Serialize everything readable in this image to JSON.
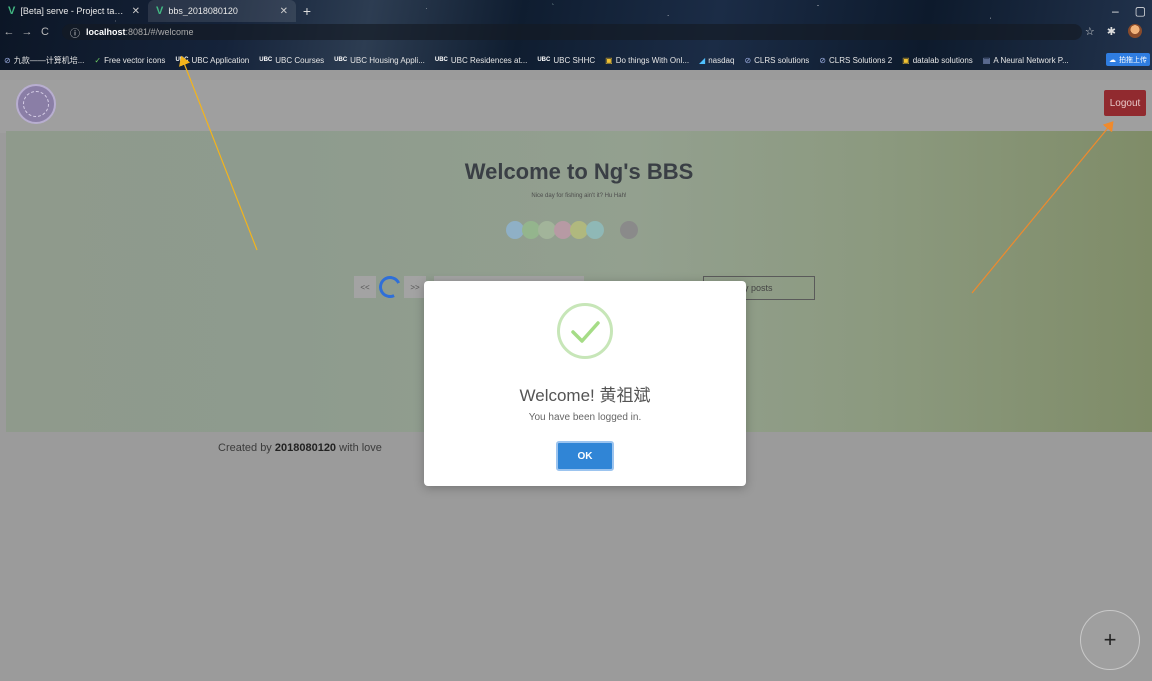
{
  "browser": {
    "tabs": [
      {
        "title": "[Beta] serve - Project tasks - Vue",
        "active": false
      },
      {
        "title": "bbs_2018080120",
        "active": true
      }
    ],
    "url_host": "localhost",
    "url_rest": ":8081/#/welcome",
    "bookmarks": [
      {
        "icon": "globe",
        "label": "九款——计算机培..."
      },
      {
        "icon": "vector",
        "label": "Free vector icons"
      },
      {
        "icon": "ubc",
        "label": "UBC Application"
      },
      {
        "icon": "ubc",
        "label": "UBC Courses"
      },
      {
        "icon": "ubc",
        "label": "UBC Housing Appli..."
      },
      {
        "icon": "ubc",
        "label": "UBC Residences at..."
      },
      {
        "icon": "ubc",
        "label": "UBC SHHC"
      },
      {
        "icon": "book",
        "label": "Do things With Onl..."
      },
      {
        "icon": "nas",
        "label": "nasdaq"
      },
      {
        "icon": "globe",
        "label": "CLRS solutions"
      },
      {
        "icon": "globe",
        "label": "CLRS Solutions 2"
      },
      {
        "icon": "book",
        "label": "datalab solutions"
      },
      {
        "icon": "doc",
        "label": "A Neural Network P..."
      }
    ],
    "upload_label": "拍拖上传"
  },
  "app": {
    "logout_label": "Logout",
    "hero": {
      "title": "Welcome to Ng's BBS",
      "subtitle": "Nice day for fishing ain't it? Hu Hah!",
      "dots": [
        "#8fb0c6",
        "#94b58d",
        "#a2b49a",
        "#b79aa4",
        "#b0b87e",
        "#8fb8b6",
        "#8a8a8a"
      ]
    },
    "pager": {
      "prev_label": "<<",
      "next_label": ">>"
    },
    "myposts_label": "y posts",
    "footer": {
      "prefix": "Created by ",
      "id": "2018080120",
      "suffix": " with love"
    },
    "fab_label": "+"
  },
  "modal": {
    "title": "Welcome! 黄祖斌",
    "text": "You have been logged in.",
    "ok_label": "OK"
  }
}
